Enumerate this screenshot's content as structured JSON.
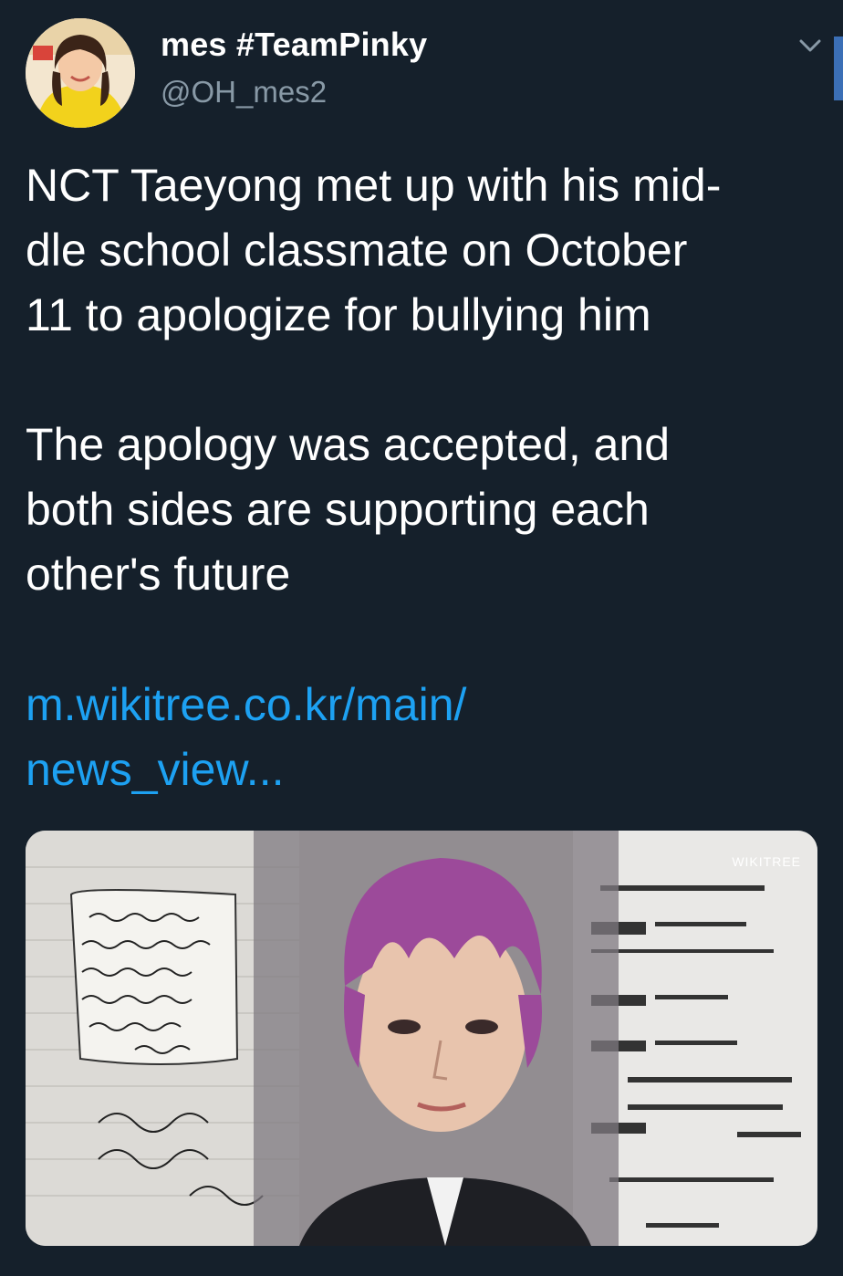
{
  "tweet": {
    "display_name": "mes #TeamPinky",
    "handle": "@OH_mes2",
    "text": "NCT Taeyong met up with his mid-\ndle school classmate on October\n11 to apologize for bullying him\n\nThe apology was accepted, and\nboth sides are supporting each\nother's future",
    "link": "m.wikitree.co.kr/main/\nnews_view..."
  },
  "media": {
    "watermark": "WIKITREE"
  },
  "icons": {
    "menu": "chevron-down-icon",
    "avatar": "avatar"
  },
  "colors": {
    "background": "#15202b",
    "text": "#ffffff",
    "secondary_text": "#8899a6",
    "link": "#1da1f2"
  }
}
